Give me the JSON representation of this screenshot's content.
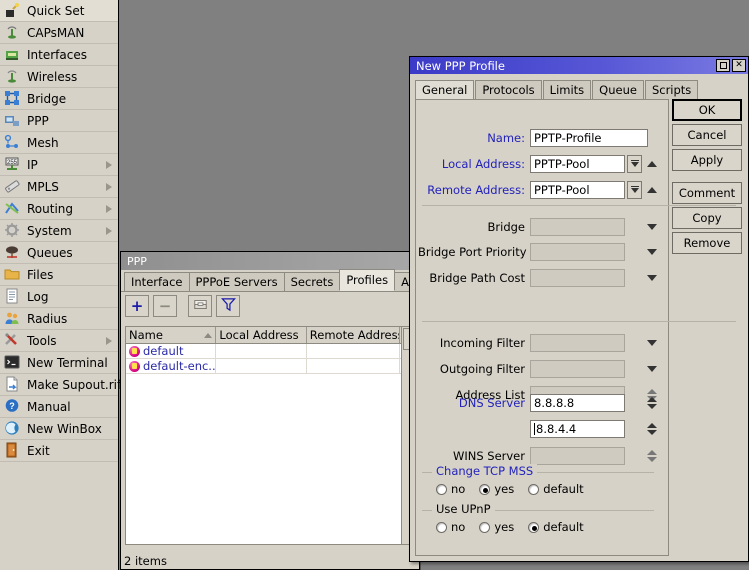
{
  "sidebar": {
    "items": [
      {
        "label": "Quick Set",
        "icon": "quickset-icon",
        "submenu": false
      },
      {
        "label": "CAPsMAN",
        "icon": "capsman-icon",
        "submenu": false
      },
      {
        "label": "Interfaces",
        "icon": "interfaces-icon",
        "submenu": false
      },
      {
        "label": "Wireless",
        "icon": "wireless-icon",
        "submenu": false
      },
      {
        "label": "Bridge",
        "icon": "bridge-icon",
        "submenu": false
      },
      {
        "label": "PPP",
        "icon": "ppp-icon",
        "submenu": false
      },
      {
        "label": "Mesh",
        "icon": "mesh-icon",
        "submenu": false
      },
      {
        "label": "IP",
        "icon": "ip-icon",
        "submenu": true
      },
      {
        "label": "MPLS",
        "icon": "mpls-icon",
        "submenu": true
      },
      {
        "label": "Routing",
        "icon": "routing-icon",
        "submenu": true
      },
      {
        "label": "System",
        "icon": "system-icon",
        "submenu": true
      },
      {
        "label": "Queues",
        "icon": "queues-icon",
        "submenu": false
      },
      {
        "label": "Files",
        "icon": "files-icon",
        "submenu": false
      },
      {
        "label": "Log",
        "icon": "log-icon",
        "submenu": false
      },
      {
        "label": "Radius",
        "icon": "radius-icon",
        "submenu": false
      },
      {
        "label": "Tools",
        "icon": "tools-icon",
        "submenu": true
      },
      {
        "label": "New Terminal",
        "icon": "terminal-icon",
        "submenu": false
      },
      {
        "label": "Make Supout.rif",
        "icon": "supout-icon",
        "submenu": false
      },
      {
        "label": "Manual",
        "icon": "manual-icon",
        "submenu": false
      },
      {
        "label": "New WinBox",
        "icon": "winbox-icon",
        "submenu": false
      },
      {
        "label": "Exit",
        "icon": "exit-icon",
        "submenu": false
      }
    ]
  },
  "ppp_window": {
    "title": "PPP",
    "tabs": [
      {
        "label": "Interface",
        "active": false
      },
      {
        "label": "PPPoE Servers",
        "active": false
      },
      {
        "label": "Secrets",
        "active": false
      },
      {
        "label": "Profiles",
        "active": true
      },
      {
        "label": "Active Co",
        "active": false
      }
    ],
    "toolbar": [
      {
        "name": "add-button",
        "glyph": "+"
      },
      {
        "name": "remove-button",
        "glyph": "−"
      },
      {
        "name": "comment-button",
        "glyph": "box"
      },
      {
        "name": "filter-button",
        "glyph": "funnel"
      }
    ],
    "table": {
      "columns": [
        "Name",
        "Local Address",
        "Remote Address",
        "B"
      ],
      "sorted_column": "Name",
      "rows": [
        {
          "name": "default",
          "local_address": "",
          "remote_address": "",
          "b": ""
        },
        {
          "name": "default-enc..",
          "local_address": "",
          "remote_address": "",
          "b": ""
        }
      ]
    },
    "status": "2 items"
  },
  "dialog": {
    "title": "New PPP Profile",
    "titlebar_buttons": [
      {
        "name": "maximize-button",
        "glyph": "□"
      },
      {
        "name": "close-button",
        "glyph": "✕"
      }
    ],
    "tabs": [
      {
        "label": "General",
        "active": true
      },
      {
        "label": "Protocols",
        "active": false
      },
      {
        "label": "Limits",
        "active": false
      },
      {
        "label": "Queue",
        "active": false
      },
      {
        "label": "Scripts",
        "active": false
      }
    ],
    "highlighted_tab": "Protocols",
    "highlight_color": "#ee1111",
    "fields": [
      {
        "label": "Name:",
        "value": "PPTP-Profile",
        "label_color": "blue",
        "control": "text",
        "enabled": true
      },
      {
        "label": "Local Address:",
        "value": "PPTP-Pool",
        "label_color": "blue",
        "control": "combo-updown",
        "enabled": true
      },
      {
        "label": "Remote Address:",
        "value": "PPTP-Pool",
        "label_color": "blue",
        "control": "combo-updown",
        "enabled": true
      },
      {
        "label": "Bridge",
        "value": "",
        "label_color": "black",
        "control": "dropdown",
        "enabled": false
      },
      {
        "label": "Bridge Port Priority",
        "value": "",
        "label_color": "black",
        "control": "dropdown",
        "enabled": false
      },
      {
        "label": "Bridge Path Cost",
        "value": "",
        "label_color": "black",
        "control": "dropdown",
        "enabled": false
      },
      {
        "label": "Incoming Filter",
        "value": "",
        "label_color": "black",
        "control": "dropdown",
        "enabled": false
      },
      {
        "label": "Outgoing Filter",
        "value": "",
        "label_color": "black",
        "control": "dropdown",
        "enabled": false
      },
      {
        "label": "Address List",
        "value": "",
        "label_color": "black",
        "control": "spinner",
        "enabled": false
      },
      {
        "label": "DNS Server",
        "value": "8.8.8.8",
        "label_color": "blue",
        "control": "spinner",
        "enabled": true
      },
      {
        "label": "",
        "value": "8.8.4.4",
        "label_color": "black",
        "control": "spinner",
        "enabled": true
      },
      {
        "label": "WINS Server",
        "value": "",
        "label_color": "black",
        "control": "spinner",
        "enabled": false
      }
    ],
    "groups": [
      {
        "title": "Change TCP MSS",
        "title_color": "blue",
        "options": [
          {
            "label": "no",
            "selected": false
          },
          {
            "label": "yes",
            "selected": true
          },
          {
            "label": "default",
            "selected": false
          }
        ]
      },
      {
        "title": "Use UPnP",
        "title_color": "black",
        "options": [
          {
            "label": "no",
            "selected": false
          },
          {
            "label": "yes",
            "selected": false
          },
          {
            "label": "default",
            "selected": true
          }
        ]
      }
    ],
    "buttons": [
      {
        "label": "OK",
        "default": true,
        "gap": false
      },
      {
        "label": "Cancel",
        "default": false,
        "gap": false
      },
      {
        "label": "Apply",
        "default": false,
        "gap": false
      },
      {
        "label": "Comment",
        "default": false,
        "gap": true
      },
      {
        "label": "Copy",
        "default": false,
        "gap": false
      },
      {
        "label": "Remove",
        "default": false,
        "gap": false
      }
    ]
  },
  "colors": {
    "desktop": "#808080",
    "panel": "#d6d2c8",
    "dialog_title": "#4040cc",
    "label_blue": "#2222bb",
    "row_text_blue": "#2a2aa8",
    "highlight_red": "#ee1111"
  }
}
